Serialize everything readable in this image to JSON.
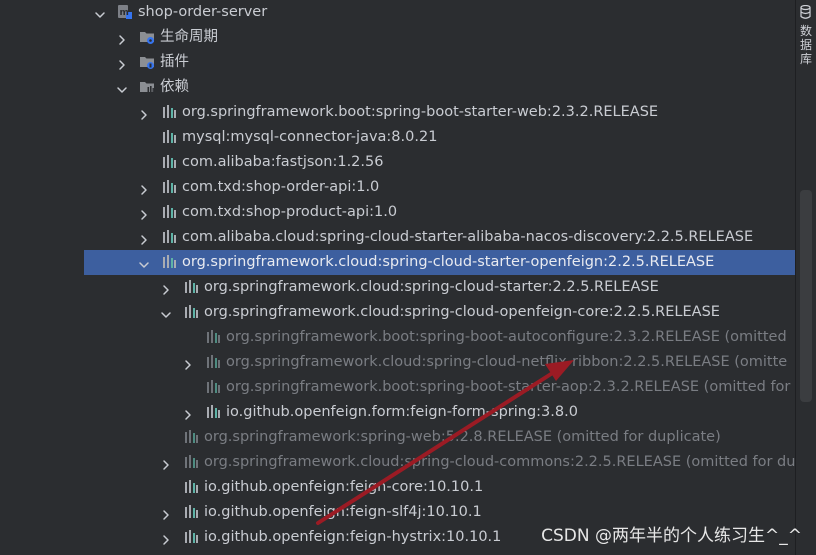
{
  "sidebar": {
    "label": "数据库",
    "icon": "database-icon"
  },
  "watermark": "CSDN @两年半的个人练习生^_^",
  "colors": {
    "selection": "#3d5f9f",
    "background": "#2b2d30",
    "arrow": "#9b1b24"
  },
  "tree": [
    {
      "label": "shop-order-server",
      "icon": "module-icon",
      "expanded": true,
      "level": 0,
      "omitted": false,
      "selected": false
    },
    {
      "label": "生命周期",
      "icon": "lifecycle-folder-icon",
      "expanded": false,
      "level": 1,
      "omitted": false,
      "selected": false
    },
    {
      "label": "插件",
      "icon": "plugins-folder-icon",
      "expanded": false,
      "level": 1,
      "omitted": false,
      "selected": false
    },
    {
      "label": "依赖",
      "icon": "dependencies-folder-icon",
      "expanded": true,
      "level": 1,
      "omitted": false,
      "selected": false
    },
    {
      "label": "org.springframework.boot:spring-boot-starter-web:2.3.2.RELEASE",
      "icon": "library-icon",
      "expanded": false,
      "level": 2,
      "omitted": false,
      "selected": false
    },
    {
      "label": "mysql:mysql-connector-java:8.0.21",
      "icon": "library-icon",
      "expanded": null,
      "level": 2,
      "omitted": false,
      "selected": false
    },
    {
      "label": "com.alibaba:fastjson:1.2.56",
      "icon": "library-icon",
      "expanded": null,
      "level": 2,
      "omitted": false,
      "selected": false
    },
    {
      "label": "com.txd:shop-order-api:1.0",
      "icon": "library-icon",
      "expanded": false,
      "level": 2,
      "omitted": false,
      "selected": false
    },
    {
      "label": "com.txd:shop-product-api:1.0",
      "icon": "library-icon",
      "expanded": false,
      "level": 2,
      "omitted": false,
      "selected": false
    },
    {
      "label": "com.alibaba.cloud:spring-cloud-starter-alibaba-nacos-discovery:2.2.5.RELEASE",
      "icon": "library-icon",
      "expanded": false,
      "level": 2,
      "omitted": false,
      "selected": false
    },
    {
      "label": "org.springframework.cloud:spring-cloud-starter-openfeign:2.2.5.RELEASE",
      "icon": "library-icon",
      "expanded": true,
      "level": 2,
      "omitted": false,
      "selected": true
    },
    {
      "label": "org.springframework.cloud:spring-cloud-starter:2.2.5.RELEASE",
      "icon": "library-icon",
      "expanded": false,
      "level": 3,
      "omitted": false,
      "selected": false
    },
    {
      "label": "org.springframework.cloud:spring-cloud-openfeign-core:2.2.5.RELEASE",
      "icon": "library-icon",
      "expanded": true,
      "level": 3,
      "omitted": false,
      "selected": false
    },
    {
      "label": "org.springframework.boot:spring-boot-autoconfigure:2.3.2.RELEASE (omitted",
      "icon": "library-icon",
      "expanded": null,
      "level": 4,
      "omitted": true,
      "selected": false
    },
    {
      "label": "org.springframework.cloud:spring-cloud-netflix-ribbon:2.2.5.RELEASE (omitte",
      "icon": "library-icon",
      "expanded": false,
      "level": 4,
      "omitted": true,
      "selected": false
    },
    {
      "label": "org.springframework.boot:spring-boot-starter-aop:2.3.2.RELEASE (omitted for d",
      "icon": "library-icon",
      "expanded": null,
      "level": 4,
      "omitted": true,
      "selected": false
    },
    {
      "label": "io.github.openfeign.form:feign-form-spring:3.8.0",
      "icon": "library-icon",
      "expanded": false,
      "level": 4,
      "omitted": false,
      "selected": false
    },
    {
      "label": "org.springframework:spring-web:5.2.8.RELEASE (omitted for duplicate)",
      "icon": "library-icon",
      "expanded": null,
      "level": 3,
      "omitted": true,
      "selected": false
    },
    {
      "label": "org.springframework.cloud:spring-cloud-commons:2.2.5.RELEASE (omitted for du",
      "icon": "library-icon",
      "expanded": false,
      "level": 3,
      "omitted": true,
      "selected": false
    },
    {
      "label": "io.github.openfeign:feign-core:10.10.1",
      "icon": "library-icon",
      "expanded": null,
      "level": 3,
      "omitted": false,
      "selected": false
    },
    {
      "label": "io.github.openfeign:feign-slf4j:10.10.1",
      "icon": "library-icon",
      "expanded": false,
      "level": 3,
      "omitted": false,
      "selected": false
    },
    {
      "label": "io.github.openfeign:feign-hystrix:10.10.1",
      "icon": "library-icon",
      "expanded": false,
      "level": 3,
      "omitted": false,
      "selected": false
    }
  ]
}
